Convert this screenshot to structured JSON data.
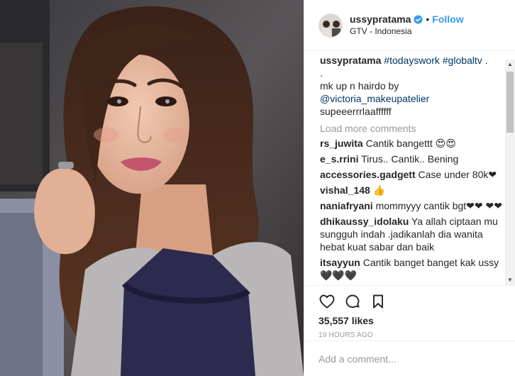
{
  "header": {
    "username": "ussypratama",
    "follow_label": "Follow",
    "location": "GTV - Indonesia"
  },
  "caption": {
    "username": "ussypratama",
    "hashtags": "#todayswork #globaltv",
    "dot": ".",
    "line2": "mk up n hairdo by",
    "mention": "@victoria_makeupatelier",
    "line4": "supeeerrrlaaffffff"
  },
  "load_more": "Load more comments",
  "comments": [
    {
      "user": "rs_juwita",
      "text": "Cantik bangettt 😍😍"
    },
    {
      "user": "e_s.rrini",
      "text": "Tirus.. Cantik.. Bening"
    },
    {
      "user": "accessories.gadgett",
      "text": "Case under 80k❤"
    },
    {
      "user": "vishal_148",
      "text": "👍"
    },
    {
      "user": "naniafryani",
      "text": "mommyyy cantik bgt❤❤ ❤❤"
    },
    {
      "user": "dhikaussy_idolaku",
      "text": "Ya allah ciptaan mu sungguh indah .jadikanlah dia wanita hebat kuat sabar dan baik"
    },
    {
      "user": "itsayyun",
      "text": "Cantik banget banget kak ussy 🖤🖤🖤"
    }
  ],
  "likes": "35,557 likes",
  "timestamp": "19 HOURS AGO",
  "comment_input": {
    "placeholder": "Add a comment..."
  },
  "colors": {
    "link": "#3897f0",
    "hashtag": "#003569",
    "muted": "#999999",
    "heart": "#e0245e"
  }
}
